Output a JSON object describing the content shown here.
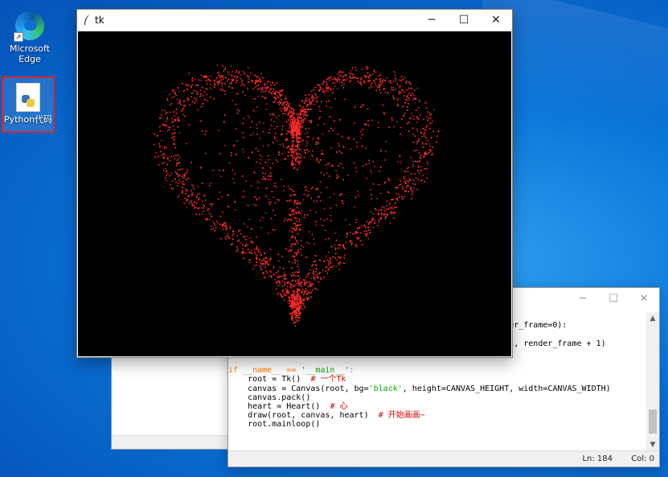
{
  "desktop": {
    "icons": [
      {
        "label": "Microsoft Edge",
        "icon": "edge-icon"
      },
      {
        "label": "Python代码",
        "icon": "python-file-icon"
      }
    ]
  },
  "tk_window": {
    "title": "tk",
    "controls": {
      "minimize": "─",
      "maximize": "☐",
      "close": "✕"
    },
    "canvas": {
      "background": "#000000",
      "particle_color": "#ff2a2a",
      "shape": "heart"
    }
  },
  "editor": {
    "controls": {
      "minimize": "─",
      "maximize": "☐",
      "close": "✕"
    },
    "code_lines": [
      "",
      "                                                  rt, render_frame=0):",
      "",
      "    main.after(160, draw, main, render_canvas, render_heart, render_frame + 1)",
      "",
      "",
      "if __name__ == '__main__':",
      "    root = Tk()  # 一个Tk",
      "    canvas = Canvas(root, bg='black', height=CANVAS_HEIGHT, width=CANVAS_WIDTH)",
      "    canvas.pack()",
      "    heart = Heart()  # 心",
      "    draw(root, canvas, heart)  # 开始画画~",
      "    root.mainloop()"
    ],
    "status": {
      "line": "Ln: 184",
      "col": "Col: 0"
    }
  }
}
